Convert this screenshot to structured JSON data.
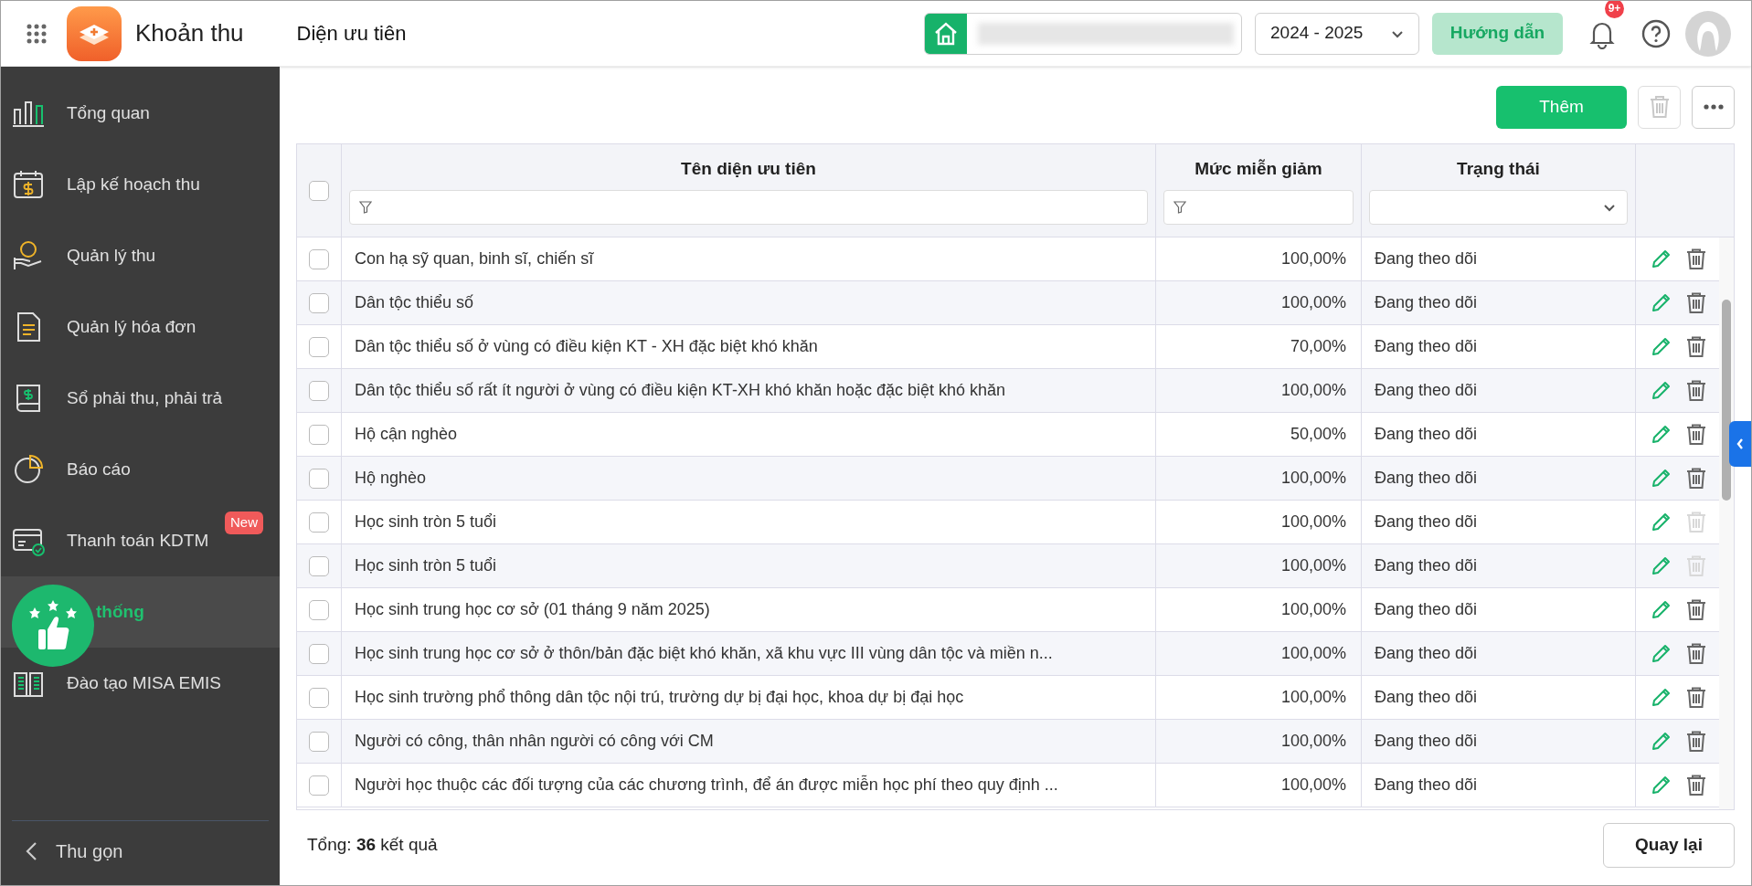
{
  "app": {
    "title": "Khoản thu"
  },
  "page_title": "Diện ưu tiên",
  "header": {
    "year": "2024 - 2025",
    "guide_button": "Hướng dẫn",
    "notification_badge": "9+"
  },
  "sidebar": {
    "items": [
      {
        "label": "Tổng quan",
        "kind": "chart",
        "selected": false
      },
      {
        "label": "Lập kế hoạch thu",
        "kind": "calendar",
        "selected": false
      },
      {
        "label": "Quản lý thu",
        "kind": "money",
        "selected": false
      },
      {
        "label": "Quản lý hóa đơn",
        "kind": "invoice",
        "selected": false
      },
      {
        "label": "Sổ phải thu, phải trả",
        "kind": "ledger",
        "selected": false
      },
      {
        "label": "Báo cáo",
        "kind": "pie",
        "selected": false
      },
      {
        "label": "Thanh toán KDTM",
        "kind": "card",
        "selected": false,
        "badge": "New"
      },
      {
        "label": "thống",
        "selected": true
      },
      {
        "label": "Đào tạo MISA EMIS",
        "kind": "book",
        "selected": false
      }
    ],
    "collapse": "Thu gọn"
  },
  "toolbar": {
    "add_button": "Thêm"
  },
  "table": {
    "columns": [
      "Tên diện ưu tiên",
      "Mức miễn giảm",
      "Trạng thái"
    ],
    "all_checked": false,
    "rows": [
      {
        "name": "Con hạ sỹ quan, binh sĩ, chiến sĩ",
        "rate": "100,00%",
        "status": "Đang theo dõi",
        "checked": false,
        "delete_disabled": false
      },
      {
        "name": "Dân tộc thiểu số",
        "rate": "100,00%",
        "status": "Đang theo dõi",
        "checked": false,
        "delete_disabled": false
      },
      {
        "name": "Dân tộc thiểu số ở vùng có điều kiện KT - XH đặc biệt khó khăn",
        "rate": "70,00%",
        "status": "Đang theo dõi",
        "checked": false,
        "delete_disabled": false
      },
      {
        "name": "Dân tộc thiểu số rất ít người ở vùng có điều kiện KT-XH khó khăn hoặc đặc biệt khó khăn",
        "rate": "100,00%",
        "status": "Đang theo dõi",
        "checked": false,
        "delete_disabled": false
      },
      {
        "name": "Hộ cận nghèo",
        "rate": "50,00%",
        "status": "Đang theo dõi",
        "checked": false,
        "delete_disabled": false
      },
      {
        "name": "Hộ nghèo",
        "rate": "100,00%",
        "status": "Đang theo dõi",
        "checked": false,
        "delete_disabled": false
      },
      {
        "name": "Học sinh tròn 5 tuổi",
        "rate": "100,00%",
        "status": "Đang theo dõi",
        "checked": false,
        "delete_disabled": true
      },
      {
        "name": "Học sinh tròn 5 tuổi",
        "rate": "100,00%",
        "status": "Đang theo dõi",
        "checked": false,
        "delete_disabled": true
      },
      {
        "name": "Học sinh trung học cơ sở (01 tháng 9 năm 2025)",
        "rate": "100,00%",
        "status": "Đang theo dõi",
        "checked": false,
        "delete_disabled": false
      },
      {
        "name": "Học sinh trung học cơ sở ở thôn/bản đặc biệt khó khăn, xã khu vực III vùng dân tộc và miền n...",
        "rate": "100,00%",
        "status": "Đang theo dõi",
        "checked": false,
        "delete_disabled": false
      },
      {
        "name": "Học sinh trường phổ thông dân tộc nội trú, trường dự bị đại học, khoa dự bị đại học",
        "rate": "100,00%",
        "status": "Đang theo dõi",
        "checked": false,
        "delete_disabled": false
      },
      {
        "name": "Người có công, thân nhân người có công với CM",
        "rate": "100,00%",
        "status": "Đang theo dõi",
        "checked": false,
        "delete_disabled": false
      },
      {
        "name": "Người học thuộc các đối tượng của các chương trình, để án được miễn học phí theo quy định ...",
        "rate": "100,00%",
        "status": "Đang theo dõi",
        "checked": false,
        "delete_disabled": false
      }
    ]
  },
  "footer": {
    "total": "Tổng: **36** kết quả",
    "back_button": "Quay lại"
  }
}
